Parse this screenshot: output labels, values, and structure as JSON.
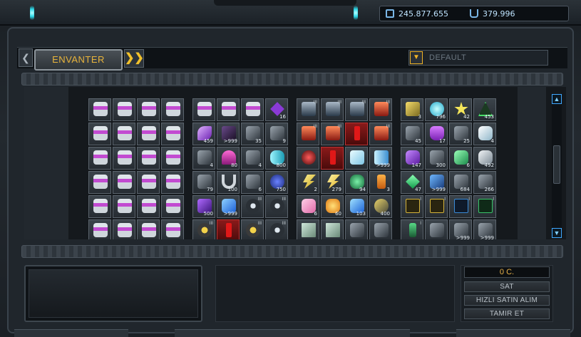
{
  "currency": {
    "credits": "245.877.655",
    "uridium": "379.996"
  },
  "tabs": {
    "active_label": "ENVANTER",
    "prev_symbol": "❮",
    "next_symbol": "❯❯"
  },
  "sort": {
    "selected": "DEFAULT",
    "arrow": "▼"
  },
  "scroll": {
    "up": "▲",
    "down": "▼"
  },
  "shop": {
    "price": "0 C.",
    "sell": "SAT",
    "quick_buy": "HIZLI SATIN ALIM",
    "repair": "TAMIR ET"
  },
  "colors": {
    "accent": "#f0b326",
    "credits_text": "#bfe4ff",
    "scroll_blue": "#3fa8ff"
  },
  "icons": {
    "credits": "credits-icon",
    "uridium": "uridium-icon"
  },
  "inventory": {
    "groups": [
      {
        "cells": [
          {
            "icon": "ammo-canister-icon",
            "count": "",
            "level": ""
          },
          {
            "icon": "ammo-canister-icon",
            "count": "",
            "level": ""
          },
          {
            "icon": "ammo-canister-icon",
            "count": "",
            "level": ""
          },
          {
            "icon": "ammo-canister-icon",
            "count": "",
            "level": ""
          },
          {
            "icon": "ammo-canister-icon",
            "count": "",
            "level": ""
          },
          {
            "icon": "ammo-canister-icon",
            "count": "",
            "level": ""
          },
          {
            "icon": "ammo-canister-icon",
            "count": "",
            "level": ""
          },
          {
            "icon": "ammo-canister-icon",
            "count": "",
            "level": ""
          },
          {
            "icon": "ammo-canister-icon",
            "count": "",
            "level": ""
          },
          {
            "icon": "ammo-canister-icon",
            "count": "",
            "level": ""
          },
          {
            "icon": "ammo-canister-icon",
            "count": "",
            "level": ""
          },
          {
            "icon": "ammo-canister-icon",
            "count": "",
            "level": ""
          },
          {
            "icon": "ammo-canister-icon",
            "count": "",
            "level": ""
          },
          {
            "icon": "ammo-canister-icon",
            "count": "",
            "level": ""
          },
          {
            "icon": "ammo-canister-icon",
            "count": "",
            "level": ""
          },
          {
            "icon": "ammo-canister-icon",
            "count": "",
            "level": ""
          },
          {
            "icon": "ammo-canister-icon",
            "count": "",
            "level": ""
          },
          {
            "icon": "ammo-canister-icon",
            "count": "",
            "level": ""
          },
          {
            "icon": "ammo-canister-icon",
            "count": "",
            "level": ""
          },
          {
            "icon": "ammo-canister-icon",
            "count": "",
            "level": ""
          },
          {
            "icon": "ammo-canister-icon",
            "count": "",
            "level": ""
          },
          {
            "icon": "ammo-canister-icon",
            "count": "",
            "level": ""
          },
          {
            "icon": "ammo-canister-icon",
            "count": "",
            "level": ""
          },
          {
            "icon": "ammo-canister-icon",
            "count": "",
            "level": ""
          }
        ]
      },
      {
        "cells": [
          {
            "icon": "ammo-canister-icon",
            "count": "",
            "level": ""
          },
          {
            "icon": "ammo-canister-icon",
            "count": "",
            "level": ""
          },
          {
            "icon": "ammo-canister-icon",
            "count": "",
            "level": ""
          },
          {
            "icon": "purple-gem-icon",
            "count": "16",
            "level": ""
          },
          {
            "icon": "purple-crystal-icon",
            "count": "459",
            "level": ""
          },
          {
            "icon": "dark-module-icon",
            "count": ">999",
            "level": ""
          },
          {
            "icon": "hammer-tool-icon",
            "count": "35",
            "level": ""
          },
          {
            "icon": "gray-part-icon",
            "count": "9",
            "level": ""
          },
          {
            "icon": "booster-device-icon",
            "count": "4",
            "level": ""
          },
          {
            "icon": "pink-cone-icon",
            "count": "80",
            "level": ""
          },
          {
            "icon": "gray-gun-icon",
            "count": "4",
            "level": ""
          },
          {
            "icon": "cyan-rocket-icon",
            "count": "800",
            "level": ""
          },
          {
            "icon": "dark-weapon-icon",
            "count": "79",
            "level": ""
          },
          {
            "icon": "magnet-icon",
            "count": "100",
            "level": ""
          },
          {
            "icon": "disk-part-icon",
            "count": "6",
            "level": ""
          },
          {
            "icon": "blue-bomb-icon",
            "count": "750",
            "level": ""
          },
          {
            "icon": "violet-shard-icon",
            "count": "500",
            "level": ""
          },
          {
            "icon": "blue-crystal-icon",
            "count": ">999",
            "level": ""
          },
          {
            "icon": "drone-icon",
            "count": "",
            "level": "III"
          },
          {
            "icon": "drone-icon",
            "count": "",
            "level": "III"
          },
          {
            "icon": "yellow-drone-icon",
            "count": "",
            "level": "III"
          },
          {
            "icon": "red-alert-icon",
            "count": "",
            "level": ""
          },
          {
            "icon": "yellow-drone-icon",
            "count": "",
            "level": "III"
          },
          {
            "icon": "drone-icon",
            "count": "",
            "level": "III"
          }
        ]
      },
      {
        "cells": [
          {
            "icon": "blue-robot-icon",
            "count": "",
            "level": "III"
          },
          {
            "icon": "blue-robot-icon",
            "count": "",
            "level": "III"
          },
          {
            "icon": "blue-robot-icon",
            "count": "",
            "level": "III"
          },
          {
            "icon": "red-robot-icon",
            "count": "",
            "level": "III"
          },
          {
            "icon": "red-robot-icon",
            "count": "",
            "level": "III"
          },
          {
            "icon": "red-robot-icon",
            "count": "",
            "level": "III"
          },
          {
            "icon": "red-alert-icon",
            "count": "",
            "level": ""
          },
          {
            "icon": "red-robot-icon",
            "count": "",
            "level": "III"
          },
          {
            "icon": "red-core-icon",
            "count": "",
            "level": ""
          },
          {
            "icon": "red-alert-icon",
            "count": "",
            "level": ""
          },
          {
            "icon": "ice-crystal-icon",
            "count": "",
            "level": ""
          },
          {
            "icon": "blue-laser-icon",
            "count": ">999",
            "level": ""
          },
          {
            "icon": "yellow-lightning-icon",
            "count": "2",
            "level": ""
          },
          {
            "icon": "lightning-icon",
            "count": "279",
            "level": ""
          },
          {
            "icon": "green-plant-icon",
            "count": "94",
            "level": ""
          },
          {
            "icon": "orange-cell-icon",
            "count": "3",
            "level": ""
          },
          {
            "icon": "pink-ore-icon",
            "count": "6",
            "level": ""
          },
          {
            "icon": "gold-ore-icon",
            "count": "60",
            "level": ""
          },
          {
            "icon": "blue-ore-icon",
            "count": "103",
            "level": ""
          },
          {
            "icon": "yellow-device-icon",
            "count": "400",
            "level": ""
          },
          {
            "icon": "panel-icon",
            "count": "",
            "level": ""
          },
          {
            "icon": "panel-icon",
            "count": "",
            "level": ""
          },
          {
            "icon": "laser-gun-icon",
            "count": "",
            "level": ""
          },
          {
            "icon": "mech-part-icon",
            "count": "",
            "level": ""
          }
        ]
      },
      {
        "cells": [
          {
            "icon": "yellow-tool-icon",
            "count": "3",
            "level": ""
          },
          {
            "icon": "cyan-burst-icon",
            "count": "796",
            "level": ""
          },
          {
            "icon": "yellow-star-icon",
            "count": "42",
            "level": ""
          },
          {
            "icon": "green-triangle-icon",
            "count": "453",
            "level": ""
          },
          {
            "icon": "wrench-icon",
            "count": "45",
            "level": ""
          },
          {
            "icon": "purple-flask-icon",
            "count": "17",
            "level": ""
          },
          {
            "icon": "cannon-icon",
            "count": "25",
            "level": ""
          },
          {
            "icon": "white-crystal-icon",
            "count": "4",
            "level": ""
          },
          {
            "icon": "violet-gem-icon",
            "count": "147",
            "level": ""
          },
          {
            "icon": "robot-arm-icon",
            "count": "300",
            "level": ""
          },
          {
            "icon": "green-jewel-icon",
            "count": "6",
            "level": ""
          },
          {
            "icon": "silver-ore-icon",
            "count": "492",
            "level": ""
          },
          {
            "icon": "green-diamond-icon",
            "count": "47",
            "level": ""
          },
          {
            "icon": "blue-circuit-icon",
            "count": ">999",
            "level": ""
          },
          {
            "icon": "drill-icon",
            "count": "684",
            "level": ""
          },
          {
            "icon": "pipe-icon",
            "count": "266",
            "level": ""
          },
          {
            "icon": "yellow-box-icon",
            "count": "",
            "level": "I"
          },
          {
            "icon": "yellow-box-icon",
            "count": "",
            "level": "I"
          },
          {
            "icon": "blue-box-icon",
            "count": "",
            "level": "I"
          },
          {
            "icon": "green-box-icon",
            "count": "",
            "level": "I"
          },
          {
            "icon": "green-tool-icon",
            "count": "",
            "level": "I"
          },
          {
            "icon": "gun-icon",
            "count": "",
            "level": ""
          },
          {
            "icon": "gun-icon",
            "count": ">999",
            "level": ""
          },
          {
            "icon": "gun-icon",
            "count": ">999",
            "level": ""
          }
        ]
      }
    ]
  }
}
